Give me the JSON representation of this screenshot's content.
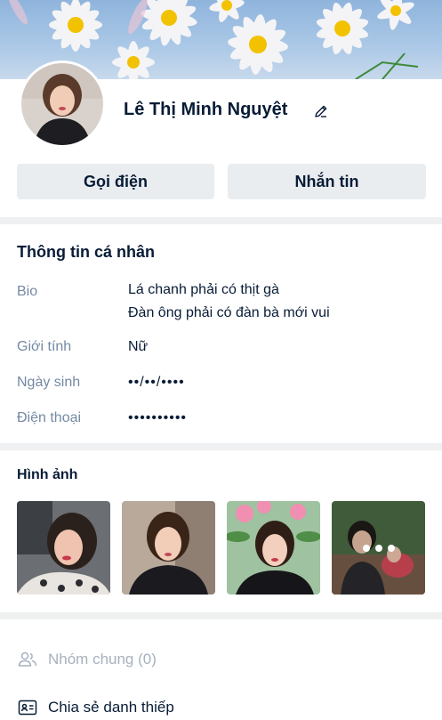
{
  "profile": {
    "name": "Lê Thị Minh Nguyệt",
    "call_label": "Gọi điện",
    "message_label": "Nhắn tin"
  },
  "personal_info": {
    "title": "Thông tin cá nhân",
    "bio_label": "Bio",
    "bio_line1": "Lá chanh phải có thịt gà",
    "bio_line2": "Đàn ông phải có đàn bà mới vui",
    "gender_label": "Giới tính",
    "gender_value": "Nữ",
    "birthday_label": "Ngày sinh",
    "birthday_value": "••/••/••••",
    "phone_label": "Điện thoại",
    "phone_value": "••••••••••"
  },
  "photos": {
    "title": "Hình ảnh"
  },
  "actions": {
    "common_groups": "Nhóm chung (0)",
    "share_card": "Chia sẻ danh thiếp"
  },
  "colors": {
    "text_primary": "#081c36",
    "text_secondary": "#7589a3",
    "button_bg": "#eaedf0",
    "divider": "#eef0f1",
    "disabled": "#a6b1bf"
  },
  "icons": {
    "edit": "pencil-icon",
    "groups": "users-icon",
    "share": "contact-card-icon",
    "more": "more-dots-icon"
  }
}
